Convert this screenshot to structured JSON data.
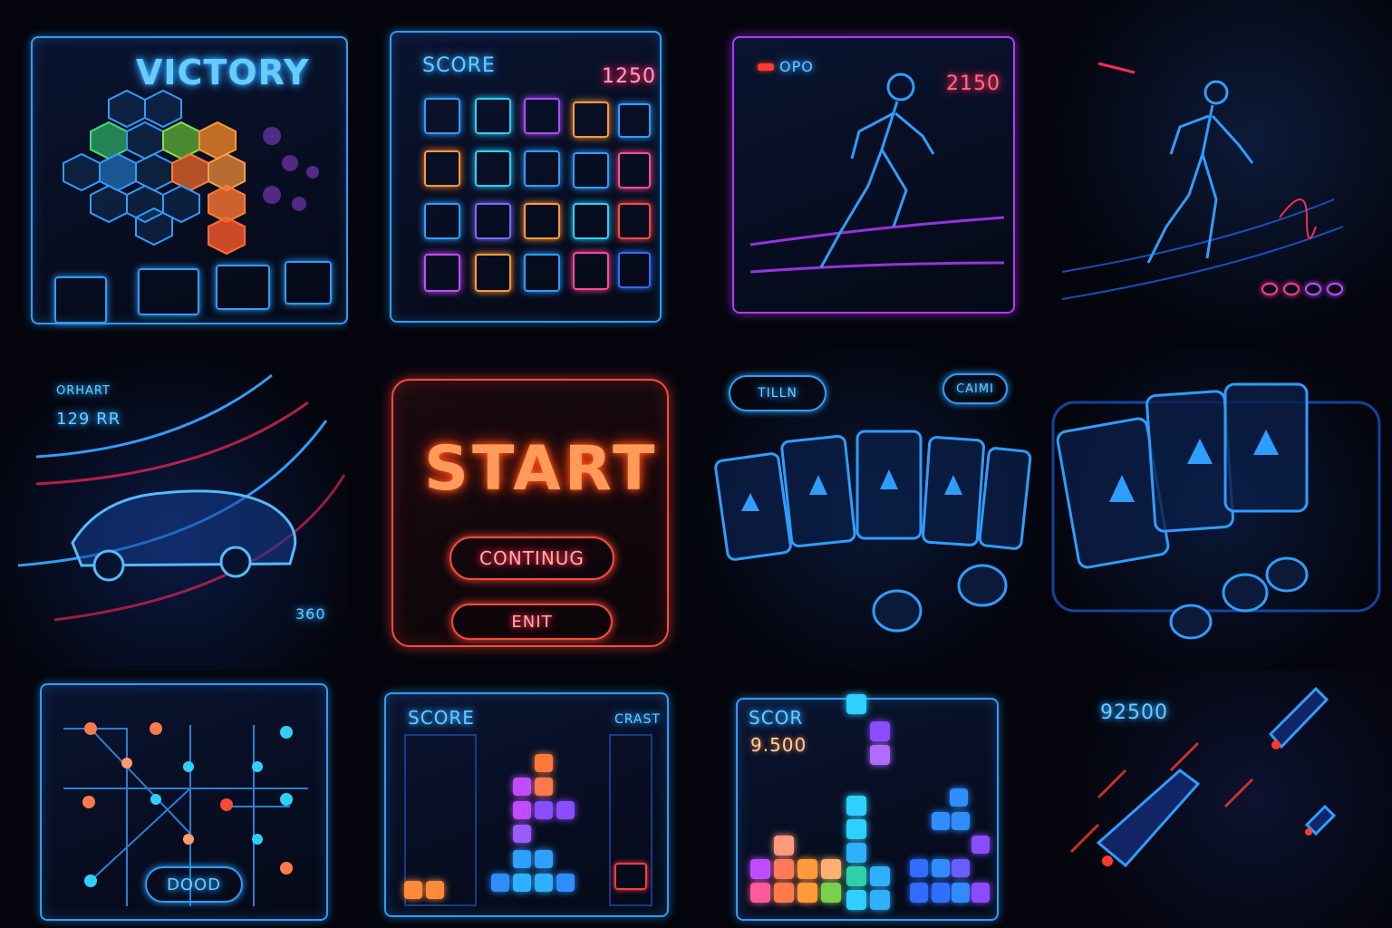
{
  "tiles": {
    "victory": {
      "title": "VICTORY"
    },
    "match": {
      "score_label": "SCORE",
      "score_value": "1250"
    },
    "runner": {
      "label": "OPO",
      "score": "2150"
    },
    "racer": {
      "label": "ORHART",
      "speed": "129 RR",
      "distance": "360"
    },
    "menu": {
      "start": "START",
      "continue": "CONTINUG",
      "exit": "ENIT"
    },
    "cards": {
      "left_button": "TILLN",
      "right_button": "CAIMI"
    },
    "network": {
      "button": "DOOD"
    },
    "tetris_a": {
      "score_label": "SCORE",
      "side_label": "CRAST"
    },
    "tetris_b": {
      "score_label": "SCOR",
      "score_value": "9.500"
    },
    "space": {
      "score": "92500"
    }
  },
  "colors": {
    "neon_blue": "#2f9dff",
    "neon_pink": "#ff2a55",
    "neon_orange": "#ff5a1e",
    "neon_purple": "#b04cff",
    "neon_green": "#3de07a",
    "background": "#04050c"
  }
}
